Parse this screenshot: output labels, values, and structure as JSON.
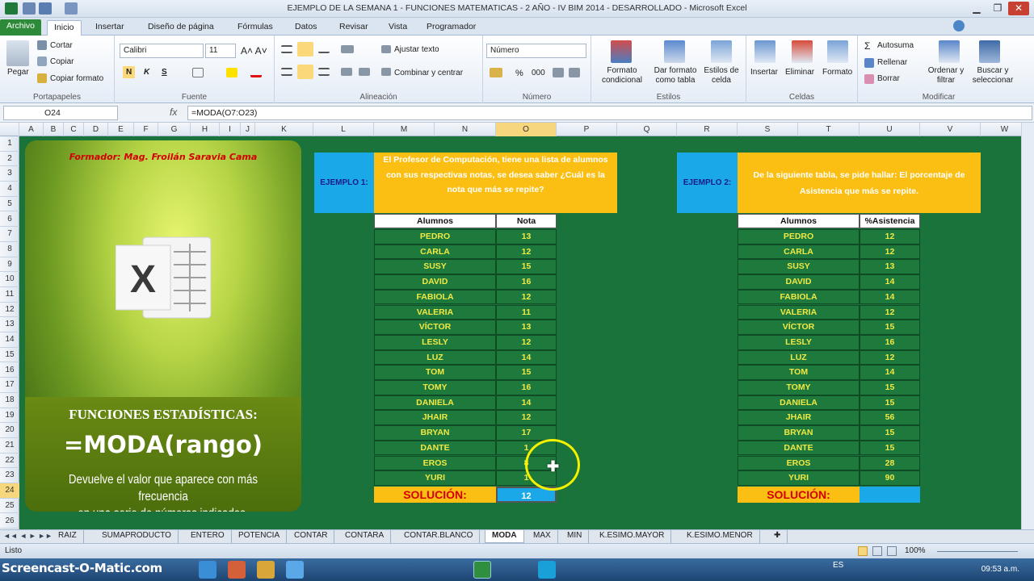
{
  "window": {
    "title": "EJEMPLO DE LA SEMANA 1 - FUNCIONES MATEMATICAS - 2 AÑO - IV BIM 2014 - DESARROLLADO  -  Microsoft Excel"
  },
  "ribbon_tabs": [
    "Archivo",
    "Inicio",
    "Insertar",
    "Diseño de página",
    "Fórmulas",
    "Datos",
    "Revisar",
    "Vista",
    "Programador"
  ],
  "ribbon": {
    "clipboard": {
      "paste": "Pegar",
      "cut": "Cortar",
      "copy": "Copiar",
      "format_painter": "Copiar formato",
      "label": "Portapapeles"
    },
    "font": {
      "name": "Calibri",
      "size": "11",
      "bold": "N",
      "italic": "K",
      "underline": "S",
      "label": "Fuente"
    },
    "alignment": {
      "wrap": "Ajustar texto",
      "merge": "Combinar y centrar",
      "label": "Alineación"
    },
    "number": {
      "format": "Número",
      "percent": "%",
      "thousands": "000",
      "label": "Número"
    },
    "styles": {
      "conditional": "Formato condicional",
      "table": "Dar formato como tabla",
      "cell": "Estilos de celda",
      "label": "Estilos"
    },
    "cells": {
      "insert": "Insertar",
      "delete": "Eliminar",
      "format": "Formato",
      "label": "Celdas"
    },
    "editing": {
      "autosum": "Autosuma",
      "fill": "Rellenar",
      "clear": "Borrar",
      "sort": "Ordenar y filtrar",
      "find": "Buscar y seleccionar",
      "label": "Modificar"
    }
  },
  "formula_bar": {
    "name_box": "O24",
    "fx": "fx",
    "formula": "=MODA(O7:O23)"
  },
  "columns": [
    "A",
    "B",
    "C",
    "D",
    "E",
    "F",
    "G",
    "H",
    "I",
    "J",
    "K",
    "L",
    "M",
    "N",
    "O",
    "P",
    "Q",
    "R",
    "S",
    "T",
    "U",
    "V",
    "W"
  ],
  "rows": [
    "1",
    "2",
    "3",
    "4",
    "5",
    "6",
    "7",
    "8",
    "9",
    "10",
    "11",
    "12",
    "13",
    "14",
    "15",
    "16",
    "17",
    "18",
    "19",
    "20",
    "21",
    "22",
    "23",
    "24",
    "25",
    "26"
  ],
  "banner": {
    "formador": "Formador: Mag. Froilán Saravia Cama",
    "logo_letter": "X",
    "title": "FUNCIONES ESTADÍSTICAS:",
    "syntax": "=MODA(rango)",
    "desc_line1": "Devuelve el valor que aparece con más frecuencia",
    "desc_line2": "en una serie de números indicados."
  },
  "example1": {
    "label": "EJEMPLO 1:",
    "question": "El Profesor de Computación, tiene una lista de alumnos con sus respectivas notas, se desea saber ¿Cuál es la nota que más se repite?",
    "header_name": "Alumnos",
    "header_value": "Nota",
    "rows": [
      [
        "PEDRO",
        "13"
      ],
      [
        "CARLA",
        "12"
      ],
      [
        "SUSY",
        "15"
      ],
      [
        "DAVID",
        "16"
      ],
      [
        "FABIOLA",
        "12"
      ],
      [
        "VALERIA",
        "11"
      ],
      [
        "VÍCTOR",
        "13"
      ],
      [
        "LESLY",
        "12"
      ],
      [
        "LUZ",
        "14"
      ],
      [
        "TOM",
        "15"
      ],
      [
        "TOMY",
        "16"
      ],
      [
        "DANIELA",
        "14"
      ],
      [
        "JHAIR",
        "12"
      ],
      [
        "BRYAN",
        "17"
      ],
      [
        "DANTE",
        "1"
      ],
      [
        "EROS",
        "8"
      ],
      [
        "YURI",
        "1"
      ]
    ],
    "solution_label": "SOLUCIÓN:",
    "solution_value": "12"
  },
  "example2": {
    "label": "EJEMPLO 2:",
    "question": "De la siguiente tabla, se pide hallar: El porcentaje de Asistencia que más se repite.",
    "header_name": "Alumnos",
    "header_value": "%Asistencia",
    "rows": [
      [
        "PEDRO",
        "12"
      ],
      [
        "CARLA",
        "12"
      ],
      [
        "SUSY",
        "13"
      ],
      [
        "DAVID",
        "14"
      ],
      [
        "FABIOLA",
        "14"
      ],
      [
        "VALERIA",
        "12"
      ],
      [
        "VÍCTOR",
        "15"
      ],
      [
        "LESLY",
        "16"
      ],
      [
        "LUZ",
        "12"
      ],
      [
        "TOM",
        "14"
      ],
      [
        "TOMY",
        "15"
      ],
      [
        "DANIELA",
        "15"
      ],
      [
        "JHAIR",
        "56"
      ],
      [
        "BRYAN",
        "15"
      ],
      [
        "DANTE",
        "15"
      ],
      [
        "EROS",
        "28"
      ],
      [
        "YURI",
        "90"
      ]
    ],
    "solution_label": "SOLUCIÓN:",
    "solution_value": ""
  },
  "sheet_tabs": [
    "RAIZ",
    "SUMAPRODUCTO",
    "ENTERO",
    "POTENCIA",
    "CONTAR",
    "CONTARA",
    "CONTAR.BLANCO",
    "MODA",
    "MAX",
    "MIN",
    "K.ESIMO.MAYOR",
    "K.ESIMO.MENOR"
  ],
  "active_sheet": "MODA",
  "status": {
    "mode": "Listo",
    "zoom": "100%"
  },
  "taskbar": {
    "watermark": "Screencast-O-Matic.com",
    "lang": "ES",
    "clock": "09:53 a.m."
  }
}
